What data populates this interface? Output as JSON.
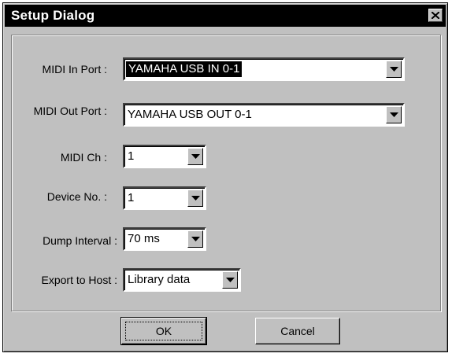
{
  "window": {
    "title": "Setup Dialog",
    "close_icon": "close-icon"
  },
  "fields": {
    "midi_in_port": {
      "label": "MIDI In Port :",
      "value": "YAMAHA USB IN 0-1"
    },
    "midi_out_port": {
      "label": "MIDI Out Port :",
      "value": "YAMAHA USB OUT 0-1"
    },
    "midi_ch": {
      "label": "MIDI Ch :",
      "value": "1"
    },
    "device_no": {
      "label": "Device No. :",
      "value": "1"
    },
    "dump_interval": {
      "label": "Dump Interval :",
      "value": "70 ms"
    },
    "export_to_host": {
      "label": "Export to Host :",
      "value": "Library data"
    }
  },
  "buttons": {
    "ok": "OK",
    "cancel": "Cancel"
  },
  "colors": {
    "face": "#c0c0c0",
    "titlebar": "#000000",
    "selection": "#000000"
  }
}
